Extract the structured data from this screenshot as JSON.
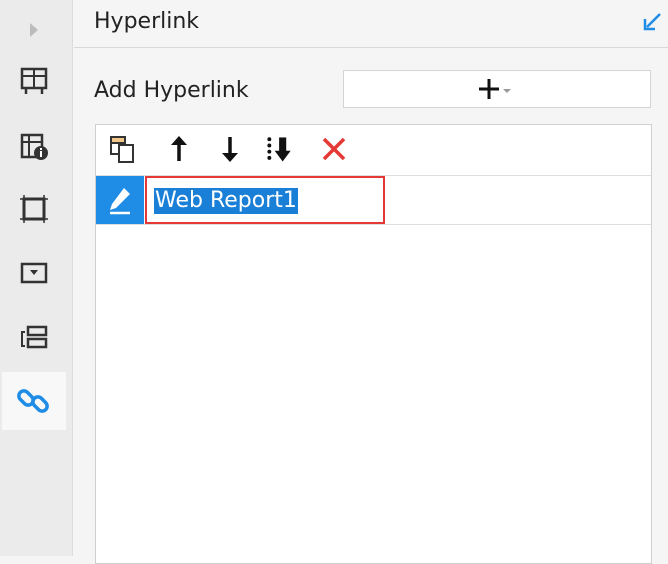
{
  "panel": {
    "title": "Hyperlink"
  },
  "add_hyperlink": {
    "label": "Add Hyperlink"
  },
  "toolbar": {
    "icons": [
      "copy-icon",
      "move-up-icon",
      "move-down-icon",
      "move-to-bottom-icon",
      "delete-icon"
    ]
  },
  "hyperlinks": [
    {
      "name": "Web Report1",
      "selected": true
    }
  ],
  "sidebar": {
    "items": [
      "frame-grid-icon",
      "cell-info-icon",
      "border-icon",
      "dropdown-icon",
      "widget-icon",
      "hyperlink-icon"
    ],
    "active_item": "hyperlink-icon"
  },
  "colors": {
    "accent": "#1f8ce6",
    "selection": "#1a7fd6",
    "delete": "#e53935",
    "highlight_border": "#e53935"
  }
}
